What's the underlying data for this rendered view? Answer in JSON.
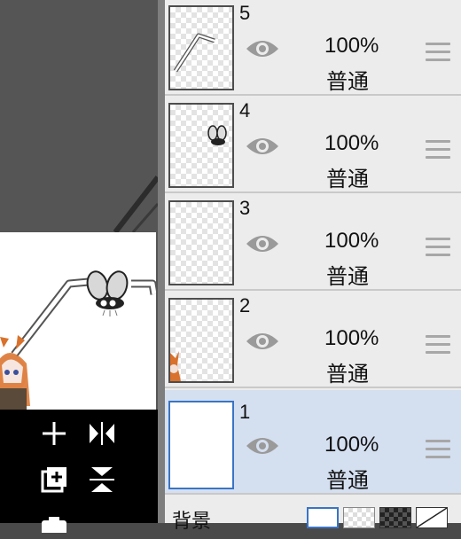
{
  "layers": [
    {
      "number": "5",
      "opacity": "100%",
      "blend": "普通",
      "selected": false
    },
    {
      "number": "4",
      "opacity": "100%",
      "blend": "普通",
      "selected": false
    },
    {
      "number": "3",
      "opacity": "100%",
      "blend": "普通",
      "selected": false
    },
    {
      "number": "2",
      "opacity": "100%",
      "blend": "普通",
      "selected": false
    },
    {
      "number": "1",
      "opacity": "100%",
      "blend": "普通",
      "selected": true
    }
  ],
  "background": {
    "label": "背景"
  },
  "icons": {
    "visibility": "eye-icon",
    "drag": "drag-handle-icon",
    "add_layer": "plus-icon",
    "flip_horizontal": "flip-horizontal-icon",
    "add_layer_copy": "add-layer-icon",
    "flip_vertical": "flip-vertical-icon",
    "camera": "camera-icon"
  },
  "colors": {
    "selected_layer": "#d4dff0",
    "selected_border": "#3a74c4",
    "panel": "#ececec"
  }
}
